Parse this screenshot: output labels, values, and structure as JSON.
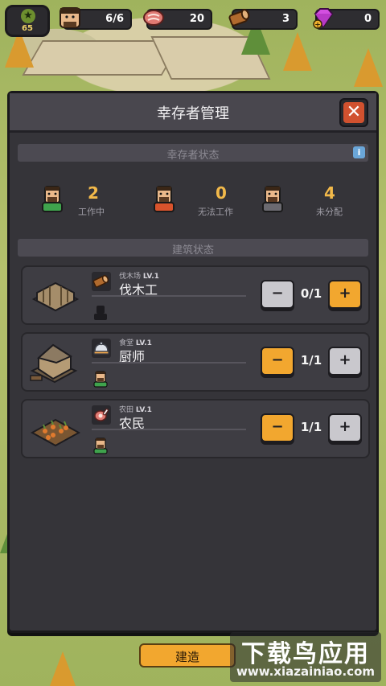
{
  "hud": {
    "level": "65",
    "survivors": "6/6",
    "meat": "20",
    "wood": "3",
    "gems": "0"
  },
  "modal": {
    "title": "幸存者管理",
    "close_glyph": "✕",
    "survivor_status_label": "幸存者状态",
    "info_glyph": "i",
    "building_status_label": "建筑状态"
  },
  "stats": [
    {
      "count": "2",
      "label": "工作中",
      "color": "#3fa34d"
    },
    {
      "count": "0",
      "label": "无法工作",
      "color": "#d9532c"
    },
    {
      "count": "4",
      "label": "未分配",
      "color": "#6b6a70"
    }
  ],
  "buildings": [
    {
      "building": "伐木场",
      "level": "LV.1",
      "job": "伐木工",
      "assigned": "0/1",
      "minus_active": false,
      "plus_active": true,
      "icon": "log-icon"
    },
    {
      "building": "食堂",
      "level": "LV.1",
      "job": "厨师",
      "assigned": "1/1",
      "minus_active": true,
      "plus_active": false,
      "icon": "cloche-icon"
    },
    {
      "building": "农田",
      "level": "LV.1",
      "job": "农民",
      "assigned": "1/1",
      "minus_active": true,
      "plus_active": false,
      "icon": "ham-icon"
    }
  ],
  "stepper": {
    "minus": "−",
    "plus": "+"
  },
  "bottom": {
    "build_label": "建造"
  },
  "watermark": {
    "title": "下载鸟应用",
    "url": "www.xiazainiao.com"
  }
}
